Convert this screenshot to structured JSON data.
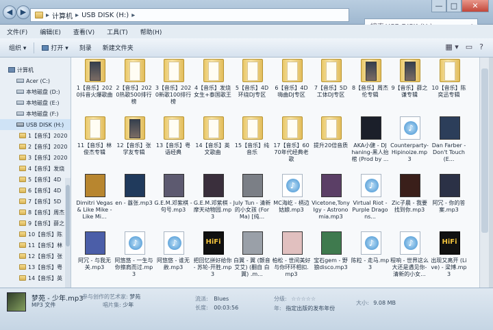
{
  "address": {
    "path": [
      "计算机",
      "USB DISK (H:)"
    ],
    "separator": "▸"
  },
  "search": {
    "placeholder": "搜索 USB DISK (H:)"
  },
  "window_controls": {
    "minimize": "—",
    "maximize": "□",
    "close": "✕"
  },
  "menu": [
    "文件(F)",
    "编辑(E)",
    "查看(V)",
    "工具(T)",
    "帮助(H)"
  ],
  "toolbar": {
    "organize": "组织 ▾",
    "open": "打开 ▾",
    "burn": "刻录",
    "new_folder": "新建文件夹"
  },
  "nav": {
    "items": [
      {
        "label": "计算机",
        "icon": "computer-icon",
        "level": "l1"
      },
      {
        "label": "Acer (C:)",
        "icon": "drive-icon",
        "level": "l2"
      },
      {
        "label": "本地磁盘 (D:)",
        "icon": "drive-icon",
        "level": "l2"
      },
      {
        "label": "本地磁盘 (E:)",
        "icon": "drive-icon",
        "level": "l2"
      },
      {
        "label": "本地磁盘 (F:)",
        "icon": "drive-icon",
        "level": "l2"
      },
      {
        "label": "USB DISK (H:)",
        "icon": "usb-drive-icon",
        "level": "l2"
      },
      {
        "label": "1【音乐】2020",
        "icon": "folder-icon",
        "level": "l3"
      },
      {
        "label": "2【音乐】2020",
        "icon": "folder-icon",
        "level": "l3"
      },
      {
        "label": "3【音乐】2020",
        "icon": "folder-icon",
        "level": "l3"
      },
      {
        "label": "4【音乐】发烧",
        "icon": "folder-icon",
        "level": "l3"
      },
      {
        "label": "5【音乐】4D",
        "icon": "folder-icon",
        "level": "l3"
      },
      {
        "label": "6【音乐】4D",
        "icon": "folder-icon",
        "level": "l3"
      },
      {
        "label": "7【音乐】5D",
        "icon": "folder-icon",
        "level": "l3"
      },
      {
        "label": "8【音乐】周杰",
        "icon": "folder-icon",
        "level": "l3"
      },
      {
        "label": "9【音乐】薛之",
        "icon": "folder-icon",
        "level": "l3"
      },
      {
        "label": "10【音乐】陈",
        "icon": "folder-icon",
        "level": "l3"
      },
      {
        "label": "11【音乐】林",
        "icon": "folder-icon",
        "level": "l3"
      },
      {
        "label": "12【音乐】张",
        "icon": "folder-icon",
        "level": "l3"
      },
      {
        "label": "13【音乐】粤",
        "icon": "folder-icon",
        "level": "l3"
      },
      {
        "label": "14【音乐】英",
        "icon": "folder-icon",
        "level": "l3"
      }
    ]
  },
  "files": [
    {
      "label": "1【音乐】2020抖音火爆歌曲",
      "type": "folder-pic"
    },
    {
      "label": "2【音乐】2020热歌500排行榜",
      "type": "folder"
    },
    {
      "label": "3【音乐】2020新歌100排行榜",
      "type": "folder"
    },
    {
      "label": "4【音乐】发烧女生+泰国歌王",
      "type": "folder"
    },
    {
      "label": "5【音乐】4D环绕DJ专区",
      "type": "folder"
    },
    {
      "label": "6【音乐】4D嗨曲DJ专区",
      "type": "folder"
    },
    {
      "label": "7【音乐】5D工体DJ专区",
      "type": "folder"
    },
    {
      "label": "8【音乐】周杰伦专辑",
      "type": "folder-pic"
    },
    {
      "label": "9【音乐】薛之谦专辑",
      "type": "folder-pic"
    },
    {
      "label": "10【音乐】陈奕迅专辑",
      "type": "folder"
    },
    {
      "label": "11【音乐】林俊杰专辑",
      "type": "folder"
    },
    {
      "label": "12【音乐】张学友专辑",
      "type": "folder-pic"
    },
    {
      "label": "13【音乐】粤语经典",
      "type": "folder"
    },
    {
      "label": "14【音乐】英文歌曲",
      "type": "folder"
    },
    {
      "label": "15【音乐】纯音乐",
      "type": "folder"
    },
    {
      "label": "17【音乐】6070年代经典老歌",
      "type": "folder"
    },
    {
      "label": "提升20倍音质",
      "type": "folder"
    },
    {
      "label": "AKA小健 - DJ haning-黑人抬棺 (Prod by ...",
      "type": "art",
      "color": "#1b1f2a"
    },
    {
      "label": "Counterparty-Hipinoize.mp3",
      "type": "audio"
    },
    {
      "label": "Dan Farber - Don't Touch (E...",
      "type": "art",
      "color": "#2c3e5a"
    },
    {
      "label": "Dimitri Vegas & Like Mike - Like Mi...",
      "type": "art",
      "color": "#b8862f"
    },
    {
      "label": "en - 囂张.mp3",
      "type": "art",
      "color": "#203a5c"
    },
    {
      "label": "G.E.M.邓紫棋 - 句号.mp3",
      "type": "art",
      "color": "#5d5a70"
    },
    {
      "label": "G.E.M.邓紫棋 - 摩天动物园.mp3",
      "type": "art",
      "color": "#3a2f3c"
    },
    {
      "label": "July Tun - 清新的小女孩 (For Ma) [纯...",
      "type": "art",
      "color": "#7b7f86"
    },
    {
      "label": "MC海屹 - 柄边姑娘.mp3",
      "type": "audio"
    },
    {
      "label": "Vicetone,Tony Igy - Astronomia.mp3",
      "type": "art",
      "color": "#5b3f66"
    },
    {
      "label": "Virtual Riot - Purple Dragons...",
      "type": "audio"
    },
    {
      "label": "Zic子晨 - 我要找到你.mp3",
      "type": "art",
      "color": "#3a1f1a"
    },
    {
      "label": "阿冗 - 你的答案.mp3",
      "type": "art",
      "color": "#2b3146"
    },
    {
      "label": "阿冗 - 与我无关.mp3",
      "type": "art",
      "color": "#4b5ea8"
    },
    {
      "label": "阿悠悠 - 一生与你擦肩而过.mp3",
      "type": "audio"
    },
    {
      "label": "阿悠悠 - 谁无赦.mp3",
      "type": "audio"
    },
    {
      "label": "把回忆拼好给你 - 苏轮-开胜.mp3",
      "type": "hifi",
      "text": "HiFi"
    },
    {
      "label": "白翼 - 翼 (颤音 艾艾) (翻自 白翼) .m...",
      "type": "art",
      "color": "#9aa0a8"
    },
    {
      "label": "柏松 - 世间美好与你环环相扣.mp3",
      "type": "art",
      "color": "#e1c0bf"
    },
    {
      "label": "宝石gem - 野狼disco.mp3",
      "type": "art",
      "color": "#3f7a4e"
    },
    {
      "label": "陈粒 - 走马.mp3",
      "type": "audio"
    },
    {
      "label": "程响 - 世界这么大还是遇见你-清新的小女...",
      "type": "audio"
    },
    {
      "label": "出现又离开 (Live) - 梁博.mp3",
      "type": "hifi",
      "text": "HiFi"
    }
  ],
  "details": {
    "title": "梦苑 - 少年.mp3",
    "filetype": "MP3 文件",
    "artist_key": "参与创作的艺术家:",
    "artist_val": "梦苑",
    "album_key": "唱片集:",
    "album_val": "少年",
    "genre_key": "流派:",
    "genre_val": "Blues",
    "length_key": "长度:",
    "length_val": "00:03:56",
    "rating_key": "分级:",
    "rating_val": "☆☆☆☆☆",
    "year_key": "年:",
    "year_val": "指定出版的发布年份",
    "size_key": "大小:",
    "size_val": "9.08 MB"
  }
}
